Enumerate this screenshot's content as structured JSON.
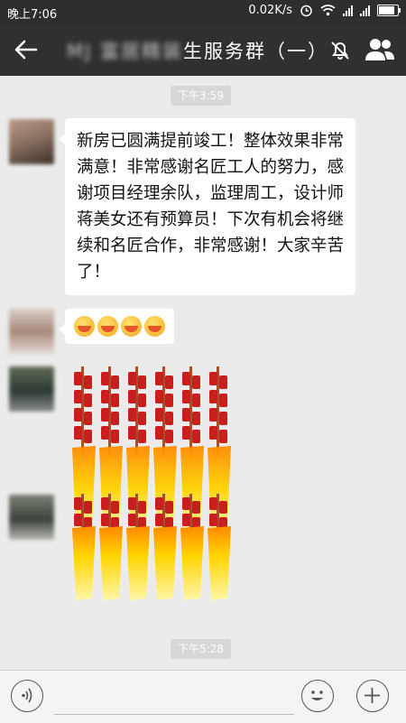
{
  "status_bar": {
    "time": "晚上7:06",
    "network_speed": "0.02K/s",
    "icons": [
      "alarm-icon",
      "wifi-icon",
      "signal-icon",
      "signal-icon",
      "battery-icon"
    ],
    "battery_level": 0.85
  },
  "nav": {
    "title_obscured": "MJ 富居精装",
    "title_visible": "生服务群（一）",
    "icons": [
      "back-arrow-icon",
      "mute-icon",
      "members-icon"
    ]
  },
  "messages": [
    {
      "type": "time",
      "text": "下午3:59"
    },
    {
      "type": "text",
      "sender_avatar": "blurred-avatar",
      "text": "新房已圆满提前竣工！整体效果非常满意！非常感谢名匠工人的努力，感谢项目经理余队，监理周工，设计师蒋美女还有预算员！下次有机会将继续和名匠合作，非常感谢！大家辛苦了！"
    },
    {
      "type": "emoji",
      "sender_avatar": "blurred-avatar",
      "emoji_count": 4,
      "emoji_name": "grinning-face"
    },
    {
      "type": "sticker",
      "sender_avatar": "blurred-avatar",
      "sticker_name": "firecrackers"
    },
    {
      "type": "sticker",
      "sender_avatar": "blurred-avatar",
      "sticker_name": "firecrackers"
    },
    {
      "type": "time",
      "text": "下午5:28"
    }
  ],
  "input_bar": {
    "icons": [
      "voice-icon",
      "emoji-icon",
      "plus-icon"
    ]
  },
  "colors": {
    "background": "#ebebeb",
    "nav_bar": "#303030",
    "status_bar": "#2e2e2e",
    "bubble": "#ffffff",
    "time_pill": "#d7d7d7"
  }
}
